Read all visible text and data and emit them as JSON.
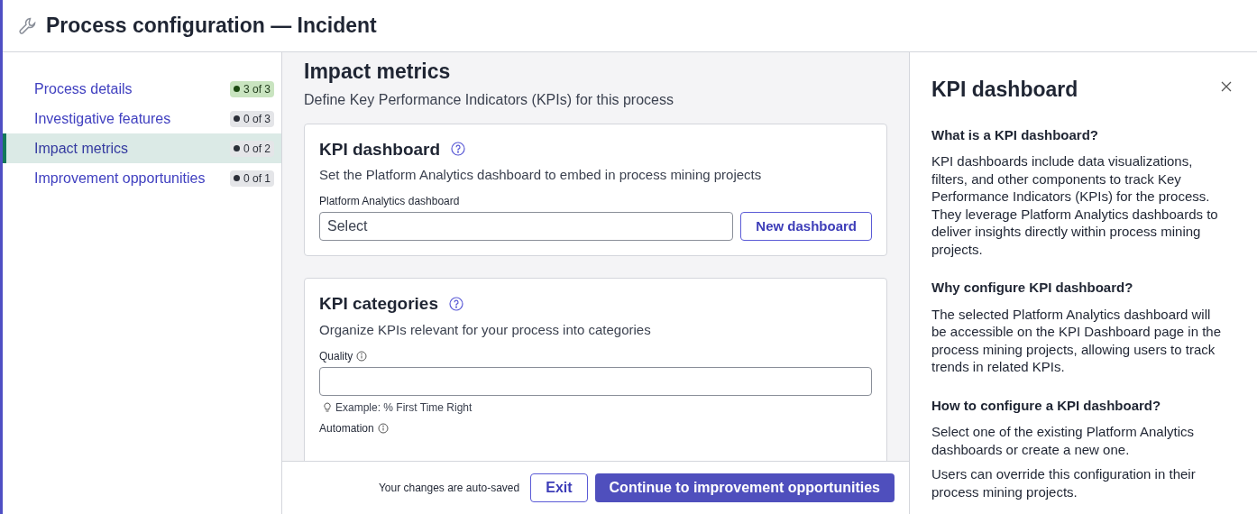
{
  "header": {
    "title": "Process configuration — Incident"
  },
  "sidebar": {
    "items": [
      {
        "label": "Process details",
        "badge": "3 of 3",
        "complete": true,
        "selected": false
      },
      {
        "label": "Investigative features",
        "badge": "0 of 3",
        "complete": false,
        "selected": false
      },
      {
        "label": "Impact metrics",
        "badge": "0 of 2",
        "complete": false,
        "selected": true
      },
      {
        "label": "Improvement opportunities",
        "badge": "0 of 1",
        "complete": false,
        "selected": false
      }
    ]
  },
  "main": {
    "title": "Impact metrics",
    "subtitle": "Define Key Performance Indicators (KPIs) for this process",
    "kpi_dashboard": {
      "title": "KPI dashboard",
      "description": "Set the Platform Analytics dashboard to embed in process mining projects",
      "field_label": "Platform Analytics dashboard",
      "placeholder": "Select",
      "button": "New dashboard"
    },
    "kpi_categories": {
      "title": "KPI categories",
      "description": "Organize KPIs relevant for your process into categories",
      "fields": [
        {
          "kind": "input",
          "label": "Quality",
          "hint": "Example: % First Time Right"
        },
        {
          "kind": "label",
          "label": "Automation"
        }
      ]
    }
  },
  "footer": {
    "note": "Your changes are auto-saved",
    "buttons": [
      "Exit",
      "Continue to improvement opportunities"
    ]
  },
  "help_panel": {
    "title": "KPI dashboard",
    "sections": [
      {
        "heading": "What is a KPI dashboard?",
        "paragraphs": [
          "KPI dashboards include data visualizations, filters, and other components to track Key Performance Indicators (KPIs) for the process. They leverage Platform Analytics dashboards to deliver insights directly within process mining projects."
        ]
      },
      {
        "heading": "Why configure KPI dashboard?",
        "paragraphs": [
          "The selected Platform Analytics dashboard will be accessible on the KPI Dashboard page in the process mining projects, allowing users to track trends in related KPIs."
        ]
      },
      {
        "heading": "How to configure a KPI dashboard?",
        "paragraphs": [
          "Select one of the existing Platform Analytics dashboards or create a new one.",
          "Users can override this configuration in their process mining projects."
        ]
      }
    ]
  }
}
